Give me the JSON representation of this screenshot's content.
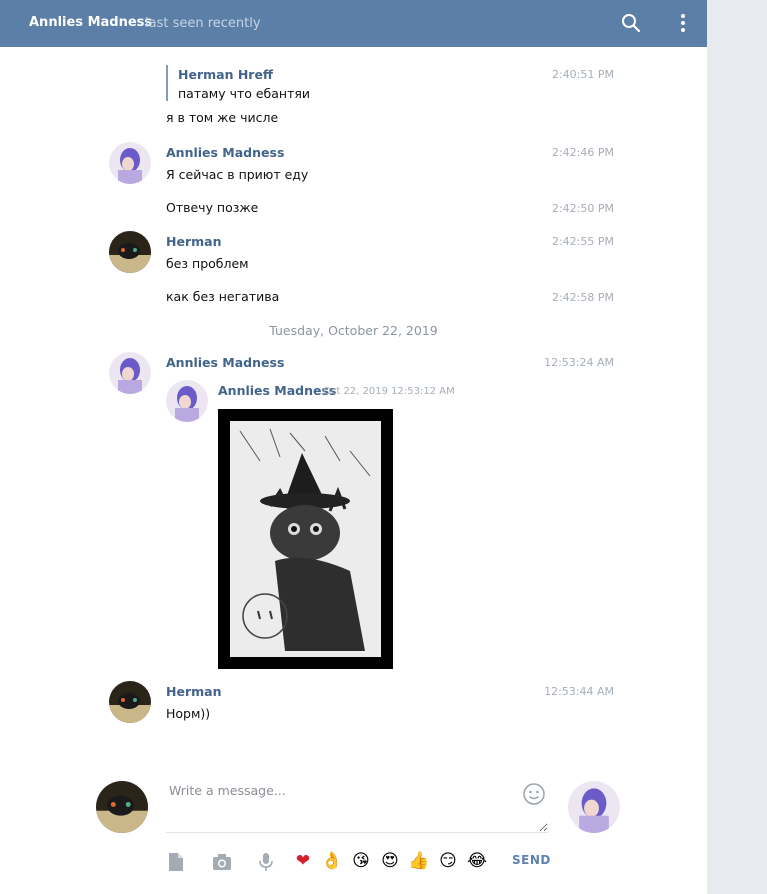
{
  "header": {
    "title": "Annlies Madness",
    "status": "last seen recently"
  },
  "messages": {
    "reply": {
      "quoted_name": "Herman Hreff",
      "quoted_text": "патаму что ебантяи",
      "time": "2:40:51 PM",
      "text": "я в том же числе"
    },
    "m1": {
      "name": "Annlies Madness",
      "text": "Я сейчас в приют еду",
      "time": "2:42:46 PM"
    },
    "m2": {
      "text": "Отвечу позже",
      "time": "2:42:50 PM"
    },
    "m3": {
      "name": "Herman",
      "text": "без проблем",
      "time": "2:42:55 PM"
    },
    "m4": {
      "text": "как без негатива",
      "time": "2:42:58 PM"
    },
    "date_separator": "Tuesday, October 22, 2019",
    "m5": {
      "name": "Annlies Madness",
      "time": "12:53:24 AM",
      "forward_name": "Annlies Madness",
      "forward_date": "Oct 22, 2019 12:53:12 AM"
    },
    "m6": {
      "name": "Herman",
      "text": "Норм))",
      "time": "12:53:44 AM"
    }
  },
  "composer": {
    "placeholder": "Write a message...",
    "send_label": "SEND",
    "emojis": [
      "❤",
      "👌",
      "😘",
      "😍",
      "👍",
      "😏",
      "😂"
    ]
  },
  "colors": {
    "header_bg": "#5b7fa6",
    "name_link": "#42648b",
    "page_bg": "#e7ebf0"
  }
}
